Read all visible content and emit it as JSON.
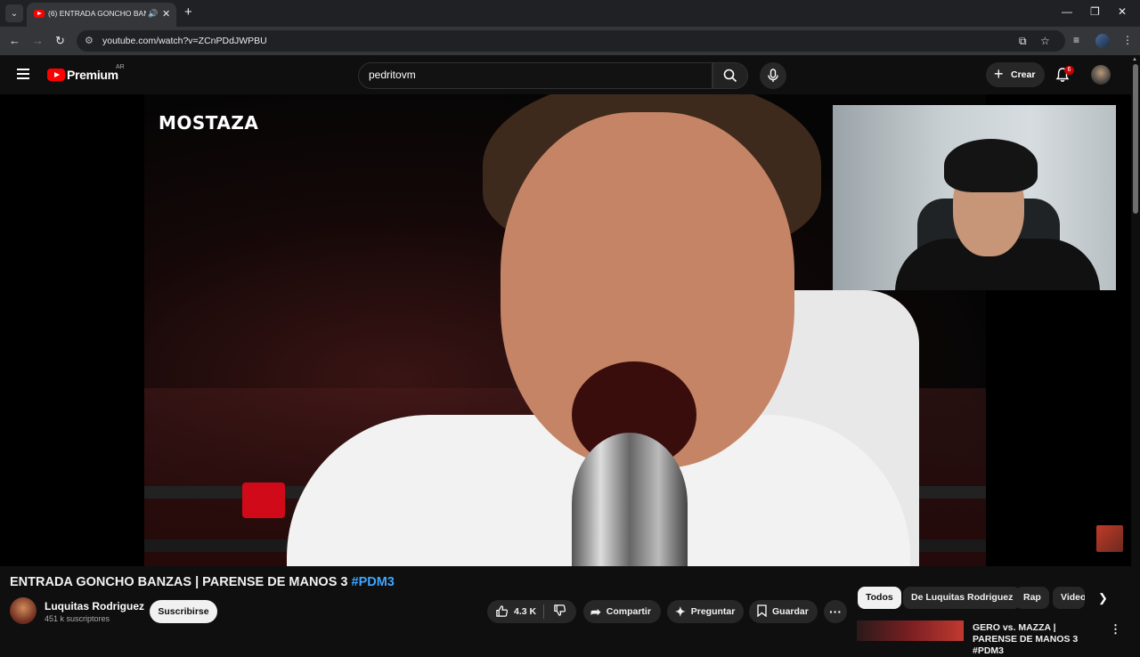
{
  "browser": {
    "tab_title": "(6) ENTRADA GONCHO BANZAS | PARENSE DE MANOS 3 #PDM3",
    "tab_close": "✕",
    "new_tab": "+",
    "url": "youtube.com/watch?v=ZCnPDdJWPBU",
    "window": {
      "minimize": "—",
      "maximize": "❐",
      "close": "✕"
    }
  },
  "header": {
    "logo_text": "Premium",
    "region": "AR",
    "search_value": "pedritovm",
    "create_label": "Crear",
    "notification_count": "6"
  },
  "video": {
    "watermark": "MOSTAZA",
    "title": "ENTRADA GONCHO BANZAS | PARENSE DE MANOS 3 ",
    "hashtag": "#PDM3"
  },
  "channel": {
    "name": "Luquitas Rodriguez",
    "subscribers": "451 k suscriptores",
    "subscribe_label": "Suscribirse"
  },
  "actions": {
    "likes": "4.3 K",
    "share": "Compartir",
    "ask": "Preguntar",
    "save": "Guardar"
  },
  "chips": [
    "Todos",
    "De Luquitas Rodriguez",
    "Rap",
    "Video"
  ],
  "recommendation": {
    "title": "GERO vs. MAZZA | PARENSE DE MANOS 3 #PDM3"
  }
}
